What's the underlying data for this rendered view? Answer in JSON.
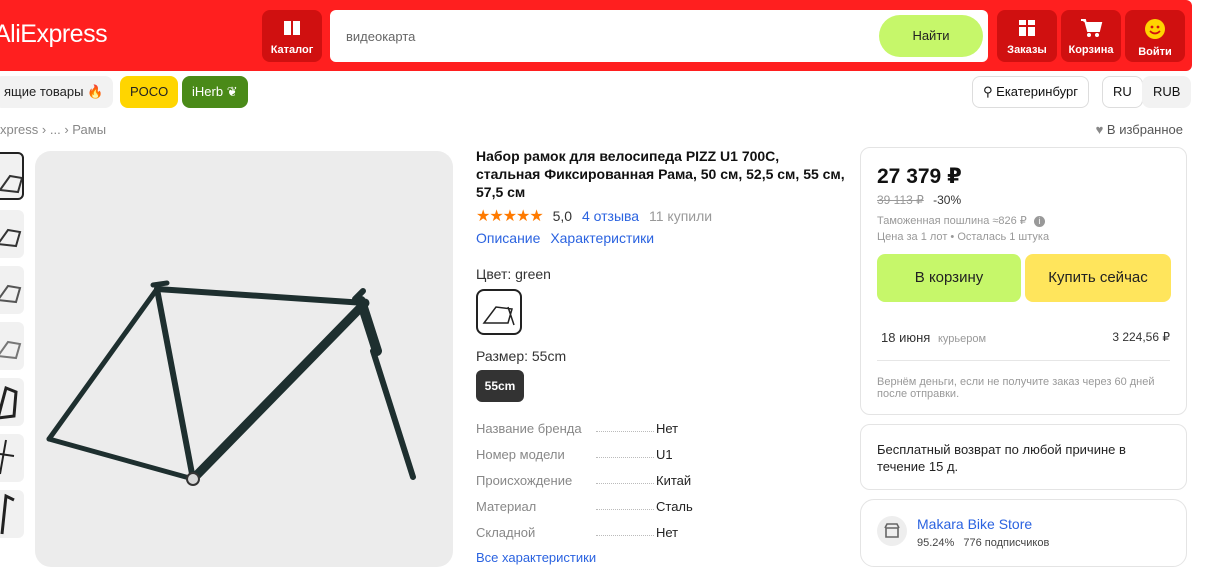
{
  "header": {
    "logo": "AliExpress",
    "catalog": "Каталог",
    "search_placeholder": "видеокарта",
    "search_button": "Найти",
    "orders": "Заказы",
    "cart": "Корзина",
    "login": "Войти"
  },
  "chips": {
    "hot": "ящие товары",
    "poco": "POCO",
    "iherb": "iHerb"
  },
  "locale": {
    "city": "Екатеринбург",
    "lang": "RU",
    "currency": "RUB"
  },
  "breadcrumb": {
    "root": "xpress",
    "ellipsis": "...",
    "current": "Рамы"
  },
  "favorites": "В избранное",
  "product": {
    "title": "Набор рамок для велосипеда PIZZ U1 700C, стальная Фиксированная Рама, 50 см, 52,5 см, 55 см, 57,5 см",
    "stars": "★★★★★",
    "rating": "5,0",
    "reviews": "4 отзыва",
    "sold": "11 купили",
    "tab_description": "Описание",
    "tab_specs": "Характеристики",
    "color_label": "Цвет: green",
    "size_label": "Размер: 55cm",
    "size_value": "55cm",
    "specs": [
      {
        "key": "Название бренда",
        "value": "Нет"
      },
      {
        "key": "Номер модели",
        "value": "U1"
      },
      {
        "key": "Происхождение",
        "value": "Китай"
      },
      {
        "key": "Материал",
        "value": "Сталь"
      },
      {
        "key": "Складной",
        "value": "Нет"
      }
    ],
    "all_specs": "Все характеристики"
  },
  "buybox": {
    "price": "27 379 ₽",
    "old_price": "39 113 ₽",
    "discount": "-30%",
    "duty": "Таможенная пошлина ≈826 ₽",
    "lot_info": "Цена за 1 лот • Осталась 1 штука",
    "add_to_cart": "В корзину",
    "buy_now": "Купить сейчас",
    "delivery_date": "18 июня",
    "delivery_type": "курьером",
    "delivery_price": "3 224,56 ₽",
    "guarantee": "Вернём деньги, если не получите заказ через 60 дней после отправки.",
    "cart_color": "#c6f76a",
    "buy_color": "#ffe55c"
  },
  "returns": {
    "text": "Бесплатный возврат по любой причине в течение 15 д."
  },
  "store": {
    "name": "Makara Bike Store",
    "rating": "95.24%",
    "subscribers": "776 подписчиков"
  }
}
